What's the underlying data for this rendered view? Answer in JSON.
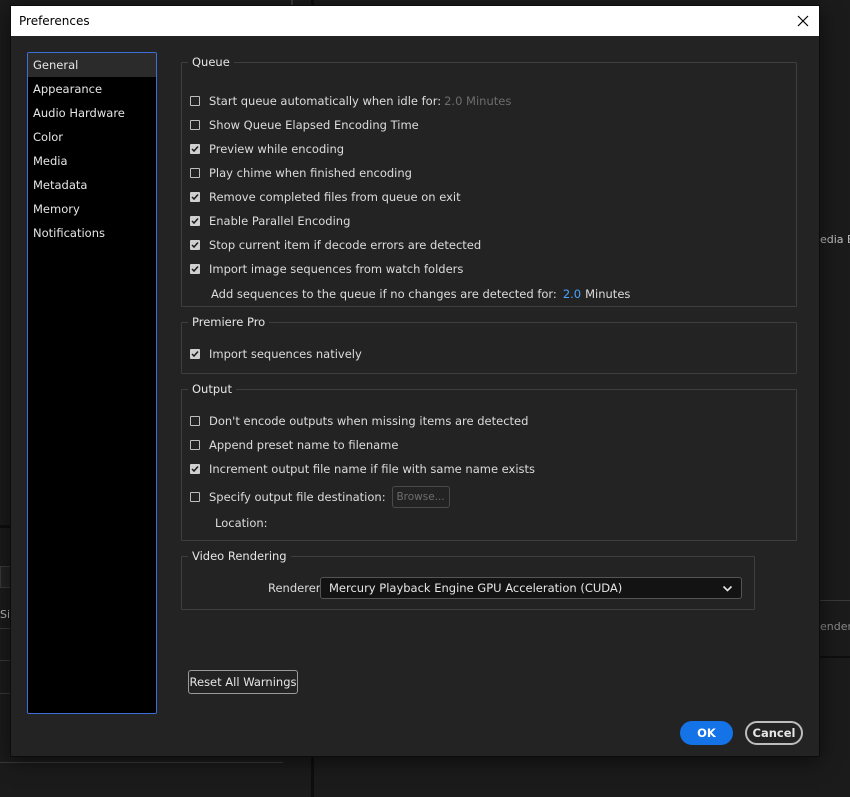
{
  "background": {
    "right_label": "edia Br",
    "right_label2": "endere",
    "left_label": "Siz"
  },
  "dialog": {
    "title": "Preferences",
    "sidebar": [
      {
        "label": "General",
        "active": true
      },
      {
        "label": "Appearance"
      },
      {
        "label": "Audio Hardware"
      },
      {
        "label": "Color"
      },
      {
        "label": "Media"
      },
      {
        "label": "Metadata"
      },
      {
        "label": "Memory"
      },
      {
        "label": "Notifications"
      }
    ],
    "queue": {
      "legend": "Queue",
      "start_auto": {
        "label": "Start queue automatically when idle for:",
        "value": "2.0 Minutes",
        "checked": false
      },
      "show_elapsed": {
        "label": "Show Queue Elapsed Encoding Time",
        "checked": false
      },
      "preview": {
        "label": "Preview while encoding",
        "checked": true
      },
      "chime": {
        "label": "Play chime when finished encoding",
        "checked": false
      },
      "remove_completed": {
        "label": "Remove completed files from queue on exit",
        "checked": true
      },
      "parallel": {
        "label": "Enable Parallel Encoding",
        "checked": true
      },
      "stop_current": {
        "label": "Stop current item if decode errors are detected",
        "checked": true
      },
      "import_sequences": {
        "label": "Import image sequences from watch folders",
        "checked": true
      },
      "add_sequences": {
        "label": "Add sequences to the queue if no changes are detected for:",
        "value": "2.0",
        "unit": "Minutes"
      }
    },
    "premiere": {
      "legend": "Premiere Pro",
      "import_native": {
        "label": "Import sequences natively",
        "checked": true
      }
    },
    "output": {
      "legend": "Output",
      "dont_encode": {
        "label": "Don't encode outputs when missing items are detected",
        "checked": false
      },
      "append_preset": {
        "label": "Append preset name to filename",
        "checked": false
      },
      "increment": {
        "label": "Increment output file name if file with same name exists",
        "checked": true
      },
      "specify_dest": {
        "label": "Specify output file destination:",
        "checked": false
      },
      "browse_label": "Browse...",
      "location_label": "Location:"
    },
    "video_rendering": {
      "legend": "Video Rendering",
      "renderer_label": "Renderer:",
      "renderer_value": "Mercury Playback Engine GPU Acceleration (CUDA)"
    },
    "buttons": {
      "reset": "Reset All Warnings",
      "ok": "OK",
      "cancel": "Cancel"
    },
    "colors": {
      "accent": "#1473e6",
      "link_value": "#4aa3ff",
      "sidebar_border": "#3d6fd8"
    }
  }
}
